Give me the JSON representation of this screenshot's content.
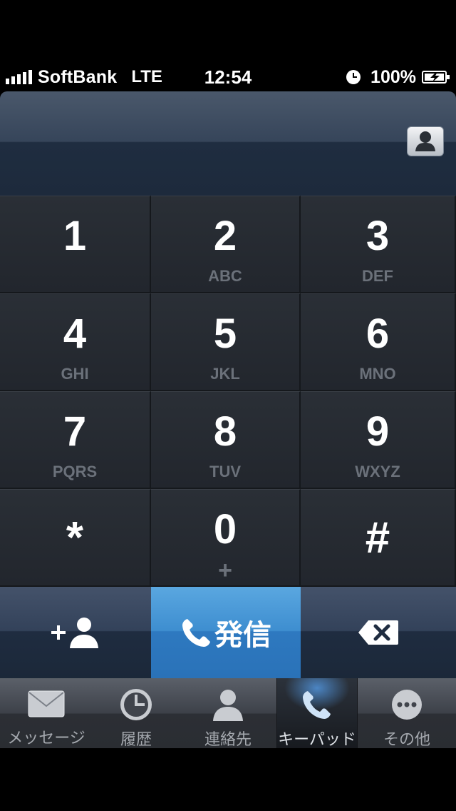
{
  "status_bar": {
    "carrier": "SoftBank",
    "network": "LTE",
    "time": "12:54",
    "battery": "100%",
    "icons": [
      "signal-icon",
      "alarm-icon",
      "battery-charging-icon"
    ]
  },
  "display": {
    "contact_button_icon": "person-icon"
  },
  "keypad": {
    "keys": [
      {
        "digit": "1",
        "letters": ""
      },
      {
        "digit": "2",
        "letters": "ABC"
      },
      {
        "digit": "3",
        "letters": "DEF"
      },
      {
        "digit": "4",
        "letters": "GHI"
      },
      {
        "digit": "5",
        "letters": "JKL"
      },
      {
        "digit": "6",
        "letters": "MNO"
      },
      {
        "digit": "7",
        "letters": "PQRS"
      },
      {
        "digit": "8",
        "letters": "TUV"
      },
      {
        "digit": "9",
        "letters": "WXYZ"
      },
      {
        "digit": "*",
        "letters": ""
      },
      {
        "digit": "0",
        "letters": "+"
      },
      {
        "digit": "#",
        "letters": ""
      }
    ]
  },
  "actions": {
    "add_contact_icon": "add-person-icon",
    "call_label": "発信",
    "delete_icon": "backspace-icon"
  },
  "tabbar": {
    "tabs": [
      {
        "label": "メッセージ",
        "icon": "envelope-icon"
      },
      {
        "label": "履歴",
        "icon": "clock-icon"
      },
      {
        "label": "連絡先",
        "icon": "contact-icon"
      },
      {
        "label": "キーパッド",
        "icon": "phone-icon"
      },
      {
        "label": "その他",
        "icon": "more-icon"
      }
    ],
    "active_index": 3
  },
  "colors": {
    "call_button": "#3e8ed0",
    "keypad_bg": "#23272e",
    "secondary_text": "#6b717a"
  }
}
